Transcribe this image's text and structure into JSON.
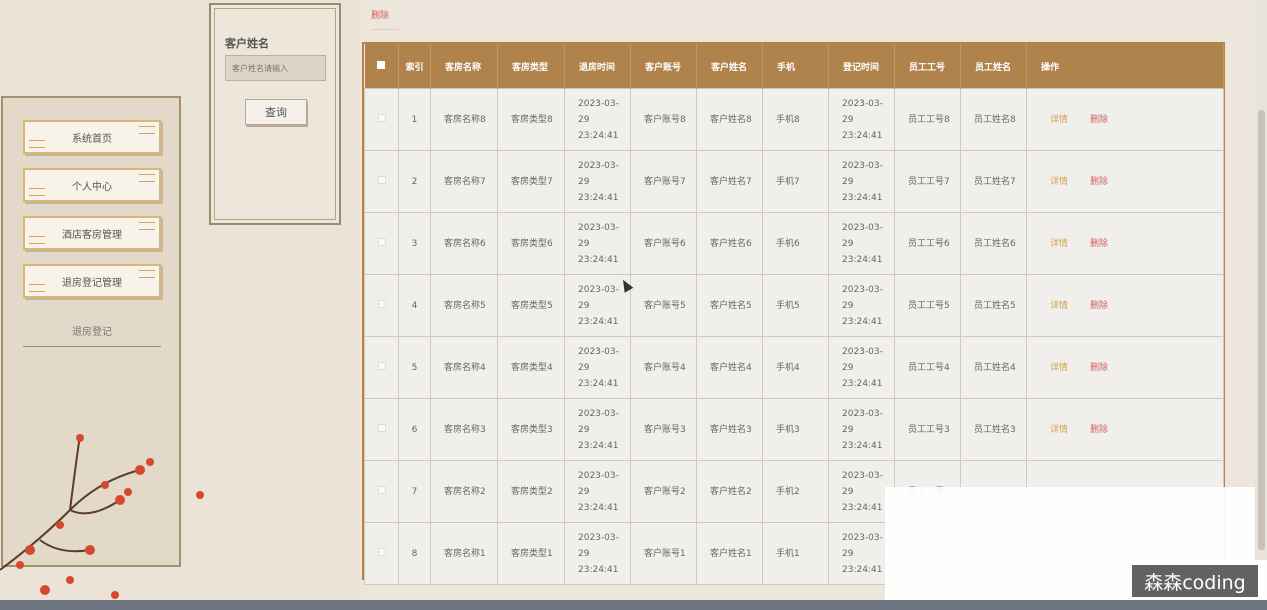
{
  "search": {
    "label": "客户姓名",
    "placeholder": "客户姓名请输入",
    "button": "查询"
  },
  "sidebar": {
    "items": [
      {
        "label": "系统首页"
      },
      {
        "label": "个人中心"
      },
      {
        "label": "酒店客房管理"
      },
      {
        "label": "退房登记管理"
      }
    ],
    "submenu_label": "退房登记"
  },
  "toolbar": {
    "delete_label": "删除"
  },
  "table": {
    "headers": [
      "索引",
      "客房名称",
      "客房类型",
      "退房时间",
      "客户账号",
      "客户姓名",
      "手机",
      "登记时间",
      "员工工号",
      "员工姓名",
      "操作"
    ],
    "rows": [
      {
        "index": "1",
        "room_name": "客房名称8",
        "room_type": "客房类型8",
        "checkout_time": "2023-03-29 23:24:41",
        "account": "客户账号8",
        "customer": "客户姓名8",
        "phone": "手机8",
        "reg_time": "2023-03-29 23:24:41",
        "staff_no": "员工工号8",
        "staff_name": "员工姓名8"
      },
      {
        "index": "2",
        "room_name": "客房名称7",
        "room_type": "客房类型7",
        "checkout_time": "2023-03-29 23:24:41",
        "account": "客户账号7",
        "customer": "客户姓名7",
        "phone": "手机7",
        "reg_time": "2023-03-29 23:24:41",
        "staff_no": "员工工号7",
        "staff_name": "员工姓名7"
      },
      {
        "index": "3",
        "room_name": "客房名称6",
        "room_type": "客房类型6",
        "checkout_time": "2023-03-29 23:24:41",
        "account": "客户账号6",
        "customer": "客户姓名6",
        "phone": "手机6",
        "reg_time": "2023-03-29 23:24:41",
        "staff_no": "员工工号6",
        "staff_name": "员工姓名6"
      },
      {
        "index": "4",
        "room_name": "客房名称5",
        "room_type": "客房类型5",
        "checkout_time": "2023-03-29 23:24:41",
        "account": "客户账号5",
        "customer": "客户姓名5",
        "phone": "手机5",
        "reg_time": "2023-03-29 23:24:41",
        "staff_no": "员工工号5",
        "staff_name": "员工姓名5"
      },
      {
        "index": "5",
        "room_name": "客房名称4",
        "room_type": "客房类型4",
        "checkout_time": "2023-03-29 23:24:41",
        "account": "客户账号4",
        "customer": "客户姓名4",
        "phone": "手机4",
        "reg_time": "2023-03-29 23:24:41",
        "staff_no": "员工工号4",
        "staff_name": "员工姓名4"
      },
      {
        "index": "6",
        "room_name": "客房名称3",
        "room_type": "客房类型3",
        "checkout_time": "2023-03-29 23:24:41",
        "account": "客户账号3",
        "customer": "客户姓名3",
        "phone": "手机3",
        "reg_time": "2023-03-29 23:24:41",
        "staff_no": "员工工号3",
        "staff_name": "员工姓名3"
      },
      {
        "index": "7",
        "room_name": "客房名称2",
        "room_type": "客房类型2",
        "checkout_time": "2023-03-29 23:24:41",
        "account": "客户账号2",
        "customer": "客户姓名2",
        "phone": "手机2",
        "reg_time": "2023-03-29 23:24:41",
        "staff_no": "员工工号",
        "staff_name": "",
        "hide_actions": true
      },
      {
        "index": "8",
        "room_name": "客房名称1",
        "room_type": "客房类型1",
        "checkout_time": "2023-03-29 23:24:41",
        "account": "客户账号1",
        "customer": "客户姓名1",
        "phone": "手机1",
        "reg_time": "2023-03-29 23:24:41",
        "staff_no": "",
        "staff_name": "",
        "hide_actions": true
      }
    ],
    "action_detail": "详情",
    "action_delete": "删除"
  },
  "watermark": "森森coding",
  "colors": {
    "header_bg": "#b0834c",
    "detail": "#d4a14b",
    "delete": "#d3625f"
  }
}
